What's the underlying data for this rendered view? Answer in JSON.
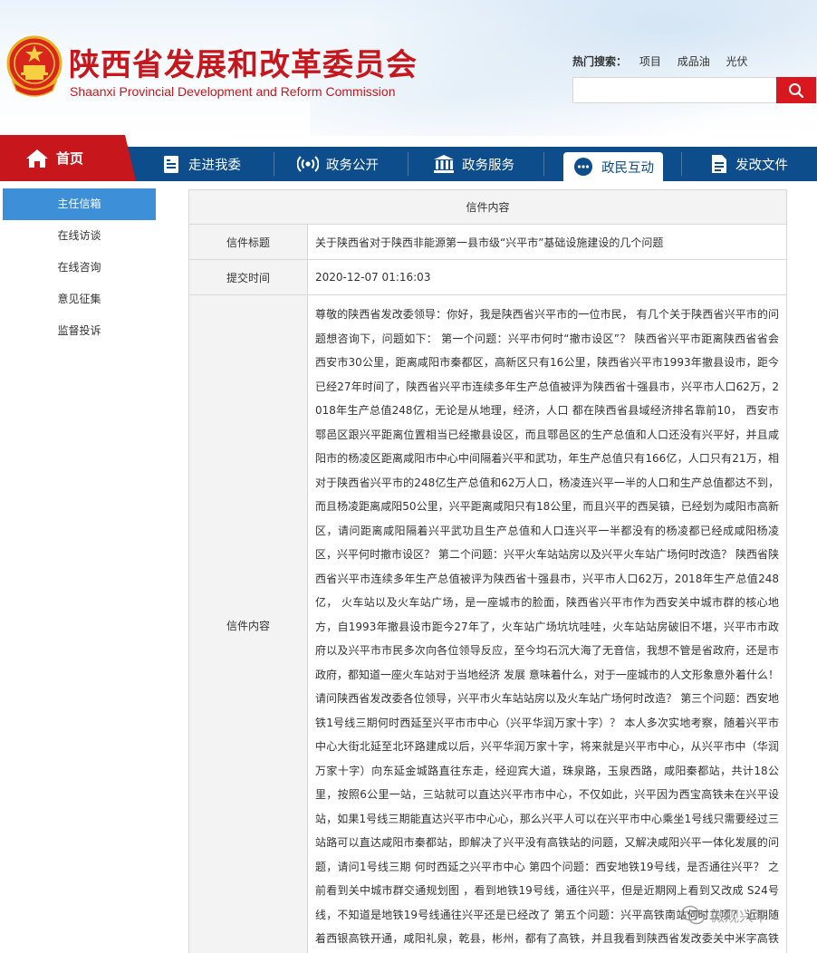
{
  "header": {
    "title": "陕西省发展和改革委员会",
    "subtitle": "Shaanxi Provincial Development and Reform Commission",
    "hot_search_label": "热门搜索：",
    "hot_keywords": [
      "项目",
      "成品油",
      "光伏"
    ],
    "search_placeholder": ""
  },
  "nav": {
    "home": "首页",
    "items": [
      {
        "label": "走进我委",
        "icon": "building-icon"
      },
      {
        "label": "政务公开",
        "icon": "broadcast-icon"
      },
      {
        "label": "政务服务",
        "icon": "institution-icon"
      },
      {
        "label": "政民互动",
        "icon": "chat-bubble-icon"
      },
      {
        "label": "发改文件",
        "icon": "document-icon"
      }
    ],
    "active": "政民互动"
  },
  "sidebar": {
    "items": [
      "主任信箱",
      "在线访谈",
      "在线咨询",
      "意见征集",
      "监督投诉"
    ],
    "active": "主任信箱"
  },
  "letter": {
    "table_title": "信件内容",
    "subject_label": "信件标题",
    "subject": "关于陕西省对于陕西非能源第一县市级“兴平市”基础设施建设的几个问题",
    "time_label": "提交时间",
    "time": "2020-12-07 01:16:03",
    "content_label": "信件内容",
    "content": "尊敬的陕西省发改委领导：你好，我是陕西省兴平市的一位市民， 有几个关于陕西省兴平市的问题想咨询下，问题如下： 第一个问题：兴平市何时“撤市设区”？ 陕西省兴平市距离陕西省省会西安市30公里，距离咸阳市秦都区，高新区只有16公里，陕西省兴平市1993年撤县设市，距今已经27年时间了，陕西省兴平市连续多年生产总值被评为陕西省十强县市，兴平市人口62万，2018年生产总值248亿，无论是从地理，经济，人口 都在陕西省县域经济排名靠前10， 西安市鄠邑区跟兴平距离位置相当已经撤县设区，而且鄠邑区的生产总值和人口还没有兴平好，并且咸阳市的杨凌区距离咸阳市中心中间隔着兴平和武功，年生产总值只有166亿，人口只有21万，相对于陕西省兴平市的248亿生产总值和62万人口，杨凌连兴平一半的人口和生产总值都达不到，而且杨凌距离咸阳50公里，兴平距离咸阳只有18公里，而且兴平的西吴镇，已经划为咸阳市高新区，请问距离咸阳隔着兴平武功且生产总值和人口连兴平一半都没有的杨凌都已经成咸阳杨凌区，兴平何时撤市设区？ 第二个问题：兴平火车站站房以及兴平火车站广场何时改造？ 陕西省陕西省兴平市连续多年生产总值被评为陕西省十强县市，兴平市人口62万，2018年生产总值248亿， 火车站以及火车站广场，是一座城市的脸面，陕西省兴平市作为西安关中城市群的核心地方，自1993年撤县设市距今27年了，火车站广场坑坑哇哇，火车站站房破旧不堪，兴平市市政府以及兴平市市民多次向各位领导反应，至今均石沉大海了无音信，我想不管是省政府，还是市政府，都知道一座火车站对于当地经济 发展 意味着什么，对于一座城市的人文形象意外着什么！请问陕西省发改委各位领导，兴平市火车站站房以及火车站广场何时改造？ 第三个问题：西安地铁1号线三期何时西延至兴平市市中心（兴平华润万家十字）？ 本人多次实地考察，随着兴平市中心大街北延至北环路建成以后，兴平华润万家十字，将来就是兴平市中心，从兴平市中（华润万家十字）向东延金城路直往东走，经迎宾大道，珠泉路，玉泉西路，咸阳秦都站，共计18公里，按照6公里一站，三站就可以直达兴平市市中心，不仅如此，兴平因为西宝高铁未在兴平设站，如果1号线三期能直达兴平市中心心，那么兴平人可以在兴平市中心乘坐1号线只需要经过三站路可以直达咸阳市秦都站，即解决了兴平没有高铁站的问题，又解决咸阳兴平一体化发展的问题，请问1号线三期 何时西延之兴平市中心 第四个问题：西安地铁19号线，是否通往兴平？ 之前看到关中城市群交通规划图 ，看到地铁19号线，通往兴平，但是近期网上看到又改成 S24号线，不知道是地铁19号线通往兴平还是已经改了 第五个问题：兴平高铁南站何时立项？ 近期随着西银高铁开通，咸阳礼泉，乾县，彬州，都有了高铁，并且我看到陕西省发改委关中米字高铁规划图，看到兴平北边礼泉有西银高铁礼泉站，兴平东边秦都有西宝高铁秦都站，西边杨凌有西宝高铁 杨凌站，南边鄠邑区不仅有西成高铁鄠邑站，还有将来的西法城际鄠邑站，只有兴平没有高铁站，照这样看来兴平东南西北各区县都有站，唯独兴平不仅唯独没有高铁站，而且火车站广场站"
  },
  "watermark": {
    "text": "微观兴平"
  },
  "colors": {
    "brand_red": "#c8161d",
    "nav_blue": "#0e4d8b",
    "sidebar_active": "#3d8fd8"
  }
}
